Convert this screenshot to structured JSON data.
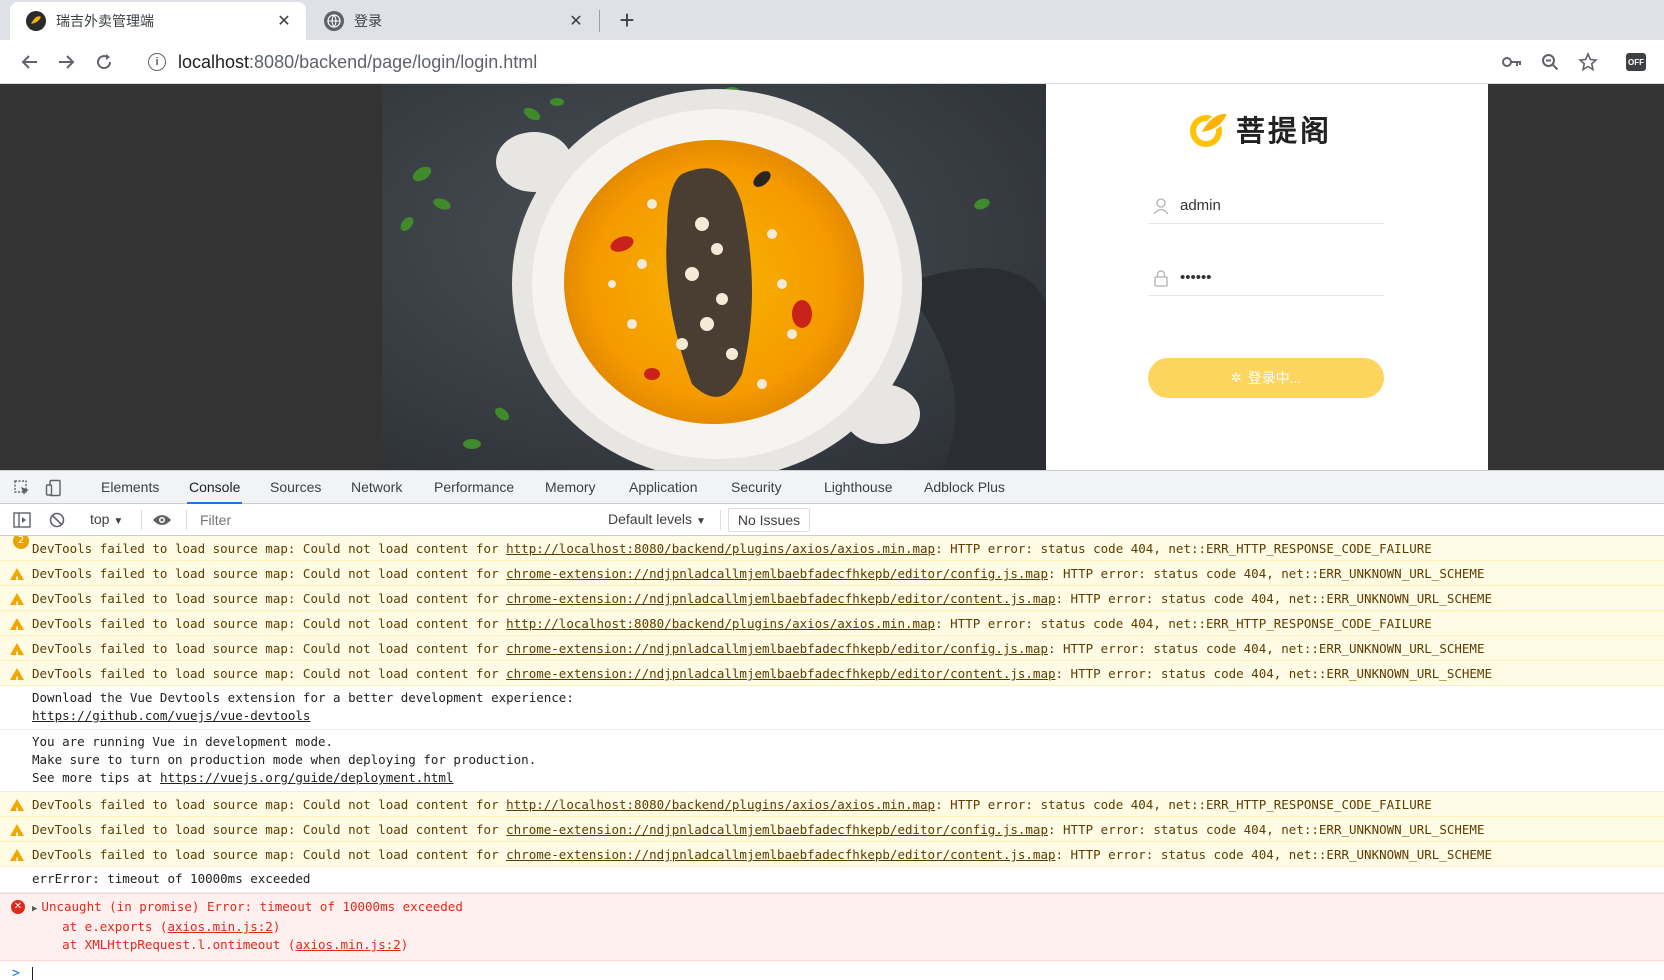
{
  "browser": {
    "tabs": [
      {
        "title": "瑞吉外卖管理端",
        "active": true
      },
      {
        "title": "登录",
        "active": false
      }
    ],
    "url_host": "localhost",
    "url_rest": ":8080/backend/page/login/login.html",
    "ext_badge": "OFF"
  },
  "login": {
    "logo_text": "菩提阁",
    "username": "admin",
    "password": "••••••",
    "button_label": "登录中..."
  },
  "devtools": {
    "tabs": [
      "Elements",
      "Console",
      "Sources",
      "Network",
      "Performance",
      "Memory",
      "Application",
      "Security",
      "Lighthouse",
      "Adblock Plus"
    ],
    "active_tab": "Console",
    "context": "top",
    "filter_placeholder": "Filter",
    "levels": "Default levels",
    "issues": "No Issues"
  },
  "console": {
    "warn_prefix": "DevTools failed to load source map: Could not load content for ",
    "top_partial": {
      "count": "2",
      "prefix": "DevTools failed to load source map: Could not load content for ",
      "url": "http://localhost:8080/backend/plugins/axios/axios.min.map",
      "suffix": ": HTTP error: status code 404, net::ERR_HTTP_RESPONSE_CODE_FAILURE"
    },
    "warnings_a": [
      {
        "url": "chrome-extension://ndjpnladcallmjemlbaebfadecfhkepb/editor/config.js.map",
        "suffix": ": HTTP error: status code 404, net::ERR_UNKNOWN_URL_SCHEME"
      },
      {
        "url": "chrome-extension://ndjpnladcallmjemlbaebfadecfhkepb/editor/content.js.map",
        "suffix": ": HTTP error: status code 404, net::ERR_UNKNOWN_URL_SCHEME"
      },
      {
        "url": "http://localhost:8080/backend/plugins/axios/axios.min.map",
        "suffix": ": HTTP error: status code 404, net::ERR_HTTP_RESPONSE_CODE_FAILURE"
      },
      {
        "url": "chrome-extension://ndjpnladcallmjemlbaebfadecfhkepb/editor/config.js.map",
        "suffix": ": HTTP error: status code 404, net::ERR_UNKNOWN_URL_SCHEME"
      },
      {
        "url": "chrome-extension://ndjpnladcallmjemlbaebfadecfhkepb/editor/content.js.map",
        "suffix": ": HTTP error: status code 404, net::ERR_UNKNOWN_URL_SCHEME"
      }
    ],
    "vue_devtools_line": "Download the Vue Devtools extension for a better development experience:",
    "vue_devtools_link": "https://github.com/vuejs/vue-devtools",
    "vue_dev_line1": "You are running Vue in development mode.",
    "vue_dev_line2": "Make sure to turn on production mode when deploying for production.",
    "vue_dev_line3_prefix": "See more tips at ",
    "vue_dev_link": "https://vuejs.org/guide/deployment.html",
    "warnings_b": [
      {
        "url": "http://localhost:8080/backend/plugins/axios/axios.min.map",
        "suffix": ": HTTP error: status code 404, net::ERR_HTTP_RESPONSE_CODE_FAILURE"
      },
      {
        "url": "chrome-extension://ndjpnladcallmjemlbaebfadecfhkepb/editor/config.js.map",
        "suffix": ": HTTP error: status code 404, net::ERR_UNKNOWN_URL_SCHEME"
      },
      {
        "url": "chrome-extension://ndjpnladcallmjemlbaebfadecfhkepb/editor/content.js.map",
        "suffix": ": HTTP error: status code 404, net::ERR_UNKNOWN_URL_SCHEME"
      }
    ],
    "err_log": "errError: timeout of 10000ms exceeded",
    "uncaught": "Uncaught (in promise) Error: timeout of 10000ms exceeded",
    "stack1_prefix": "    at e.exports (",
    "stack1_link": "axios.min.js:2",
    "stack1_suffix": ")",
    "stack2_prefix": "    at XMLHttpRequest.l.ontimeout (",
    "stack2_link": "axios.min.js:2",
    "stack2_suffix": ")",
    "prompt": ">"
  },
  "colors": {
    "accent": "#1a73e8",
    "login_button": "#fdd55e",
    "warning": "#f2a600",
    "error": "#e0281b"
  }
}
